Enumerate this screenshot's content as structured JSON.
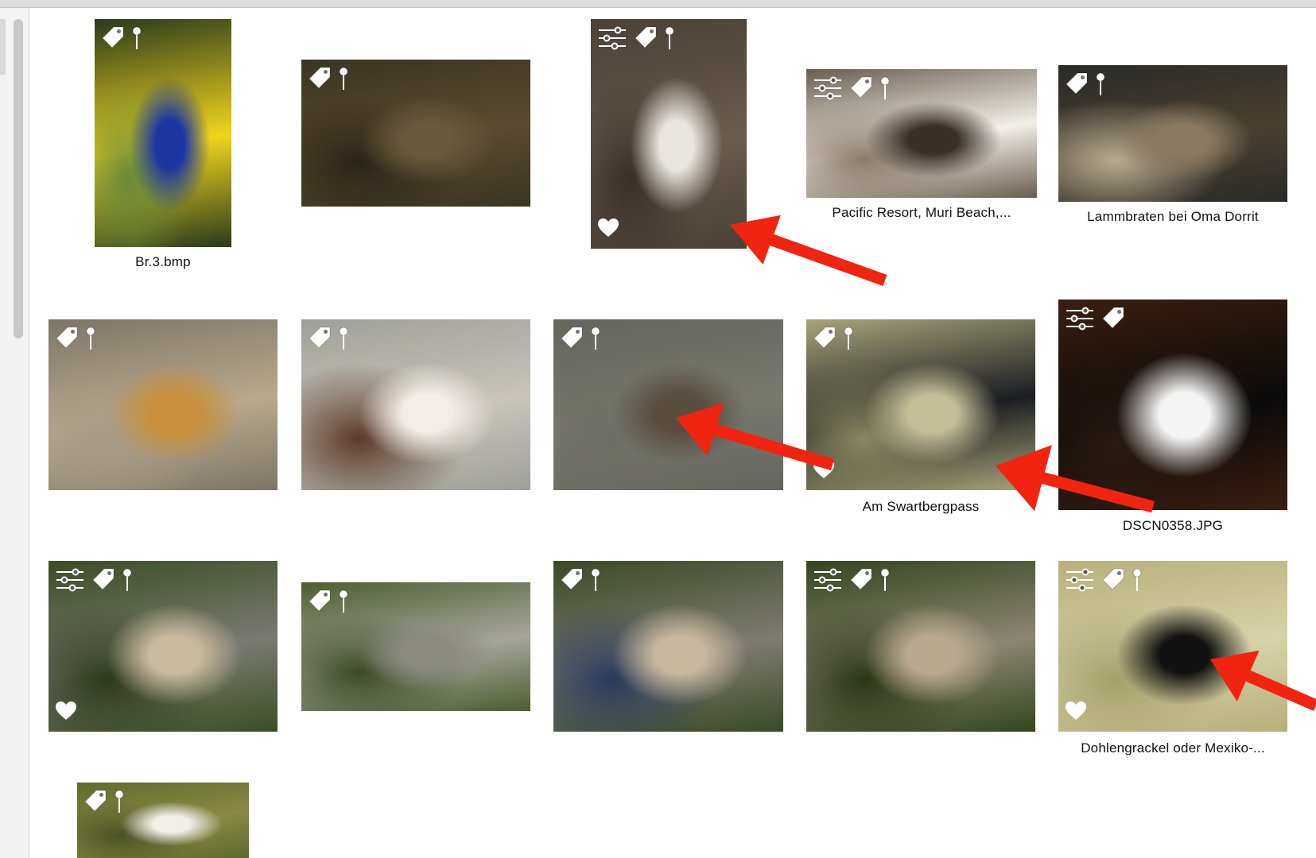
{
  "window": {
    "scrollbar": "vertical-scrollbar"
  },
  "thumbnails": [
    {
      "id": "t1",
      "label": "Br.3.bmp",
      "adjust": false,
      "tag": true,
      "pin": true,
      "heart": false,
      "colors": [
        "#2a3a1c",
        "#f0d51c",
        "#1c38a0",
        "#6a8a3a"
      ]
    },
    {
      "id": "t2",
      "label": "",
      "adjust": false,
      "tag": true,
      "pin": true,
      "heart": false,
      "colors": [
        "#3a3524",
        "#5a4a30",
        "#6a5a3c",
        "#2a2418"
      ]
    },
    {
      "id": "t3",
      "label": "",
      "adjust": true,
      "tag": true,
      "pin": true,
      "heart": true,
      "colors": [
        "#4a4036",
        "#6a5d50",
        "#e8e4de",
        "#3a302a"
      ]
    },
    {
      "id": "t4",
      "label": "Pacific Resort, Muri Beach,...",
      "adjust": true,
      "tag": true,
      "pin": true,
      "heart": false,
      "colors": [
        "#6a5d50",
        "#f2efe8",
        "#3a302a",
        "#8a7a6a"
      ]
    },
    {
      "id": "t5",
      "label": "Lammbraten bei Oma Dorrit",
      "adjust": false,
      "tag": true,
      "pin": true,
      "heart": false,
      "colors": [
        "#2a2a28",
        "#4a4030",
        "#8a7a64",
        "#b7aa92"
      ]
    },
    {
      "id": "t6",
      "label": "",
      "adjust": false,
      "tag": true,
      "pin": true,
      "heart": false,
      "colors": [
        "#7d7568",
        "#b7a98c",
        "#c9903c",
        "#a59b88"
      ]
    },
    {
      "id": "t7",
      "label": "",
      "adjust": false,
      "tag": true,
      "pin": true,
      "heart": false,
      "colors": [
        "#9ea097",
        "#c8c4bc",
        "#f2ede6",
        "#5a3a2a"
      ]
    },
    {
      "id": "t8",
      "label": "",
      "adjust": false,
      "tag": true,
      "pin": true,
      "heart": false,
      "colors": [
        "#64655c",
        "#78796f",
        "#5a4e40",
        "#6e6f66"
      ]
    },
    {
      "id": "t9",
      "label": "Am Swartbergpass",
      "adjust": false,
      "tag": true,
      "pin": true,
      "heart": true,
      "colors": [
        "#a8a47a",
        "#1b1d22",
        "#c5bf97",
        "#8a8860"
      ]
    },
    {
      "id": "t10",
      "label": "DSCN0358.JPG",
      "adjust": true,
      "tag": true,
      "pin": false,
      "heart": false,
      "colors": [
        "#3a1e10",
        "#0a0a0a",
        "#f5f5f5",
        "#2a1a12"
      ]
    },
    {
      "id": "t11",
      "label": "",
      "adjust": true,
      "tag": true,
      "pin": true,
      "heart": true,
      "colors": [
        "#3b4e24",
        "#7a7a72",
        "#c9bba0",
        "#2e3a1e"
      ]
    },
    {
      "id": "t12",
      "label": "",
      "adjust": false,
      "tag": true,
      "pin": true,
      "heart": false,
      "colors": [
        "#4c5e30",
        "#a6a59c",
        "#8a8a80",
        "#3a4a26"
      ]
    },
    {
      "id": "t13",
      "label": "",
      "adjust": false,
      "tag": true,
      "pin": true,
      "heart": false,
      "colors": [
        "#3a4a26",
        "#7f7b72",
        "#c8b8a0",
        "#2a3a5a"
      ]
    },
    {
      "id": "t14",
      "label": "",
      "adjust": true,
      "tag": true,
      "pin": true,
      "heart": false,
      "colors": [
        "#33461d",
        "#8d8576",
        "#b8a890",
        "#2a3618"
      ]
    },
    {
      "id": "t15",
      "label": "Dohlengrackel oder Mexiko-...",
      "adjust": true,
      "tag": true,
      "pin": true,
      "heart": true,
      "colors": [
        "#b7b07a",
        "#d7d2a8",
        "#121212",
        "#a4a06a"
      ]
    },
    {
      "id": "t16",
      "label": "",
      "adjust": false,
      "tag": true,
      "pin": true,
      "heart": false,
      "colors": [
        "#5f6a2c",
        "#8a8a44",
        "#f0eee8",
        "#4a5224"
      ]
    }
  ],
  "annotations": [
    {
      "name": "annotation-arrow-1",
      "color": "#f02410"
    },
    {
      "name": "annotation-arrow-2",
      "color": "#f02410"
    },
    {
      "name": "annotation-arrow-3",
      "color": "#f02410"
    },
    {
      "name": "annotation-arrow-4",
      "color": "#f02410"
    }
  ]
}
